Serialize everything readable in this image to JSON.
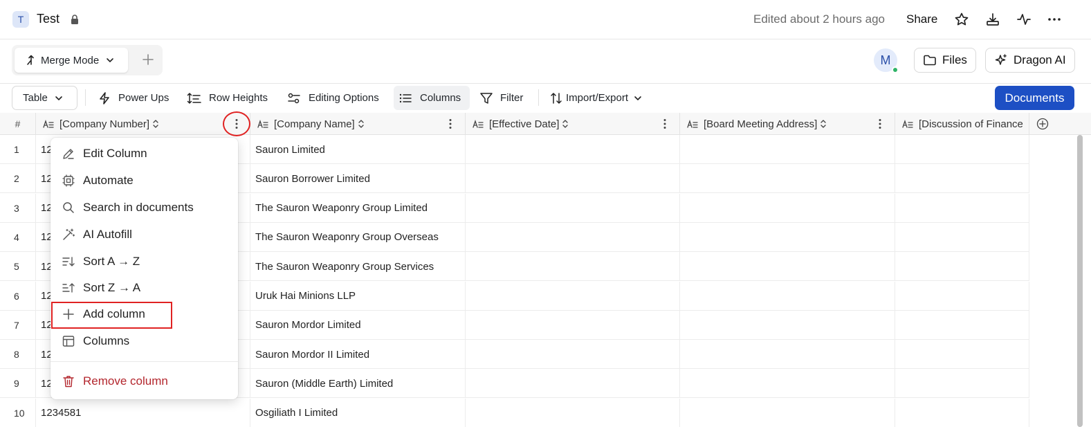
{
  "header": {
    "doc_avatar": "T",
    "title": "Test",
    "edited": "Edited about 2 hours ago",
    "share": "Share"
  },
  "tabs": {
    "merge_mode": "Merge Mode"
  },
  "user": {
    "initial": "M"
  },
  "buttons": {
    "files": "Files",
    "dragon_ai": "Dragon AI",
    "documents": "Documents"
  },
  "toolbar": {
    "table": "Table",
    "power_ups": "Power Ups",
    "row_heights": "Row Heights",
    "editing_options": "Editing Options",
    "columns": "Columns",
    "filter": "Filter",
    "import_export": "Import/Export"
  },
  "grid": {
    "hash": "#",
    "columns": [
      "[Company Number]",
      "[Company Name]",
      "[Effective Date]",
      "[Board Meeting Address]",
      "[Discussion of Finance"
    ],
    "rows": [
      {
        "num": "1",
        "number": "12",
        "name": "Sauron Limited"
      },
      {
        "num": "2",
        "number": "12",
        "name": "Sauron Borrower Limited"
      },
      {
        "num": "3",
        "number": "12",
        "name": "The Sauron Weaponry Group Limited"
      },
      {
        "num": "4",
        "number": "12",
        "name": "The Sauron Weaponry Group Overseas"
      },
      {
        "num": "5",
        "number": "12",
        "name": "The Sauron Weaponry Group Services"
      },
      {
        "num": "6",
        "number": "12",
        "name": "Uruk Hai Minions LLP"
      },
      {
        "num": "7",
        "number": "12",
        "name": "Sauron Mordor Limited"
      },
      {
        "num": "8",
        "number": "12",
        "name": "Sauron Mordor II Limited"
      },
      {
        "num": "9",
        "number": "12",
        "name": "Sauron (Middle Earth) Limited"
      },
      {
        "num": "10",
        "number": "1234581",
        "name": "Osgiliath I Limited"
      }
    ]
  },
  "menu": {
    "items": [
      {
        "label": "Edit Column",
        "icon": "pencil-icon"
      },
      {
        "label": "Automate",
        "icon": "chip-icon"
      },
      {
        "label": "Search in documents",
        "icon": "search-icon"
      },
      {
        "label": "AI Autofill",
        "icon": "magic-wand-icon"
      },
      {
        "label": "Sort A → Z",
        "icon": "sort-asc-icon"
      },
      {
        "label": "Sort Z → A",
        "icon": "sort-desc-icon"
      },
      {
        "label": "Add column",
        "icon": "plus-icon"
      },
      {
        "label": "Columns",
        "icon": "table-icon"
      }
    ],
    "remove": {
      "label": "Remove column",
      "icon": "trash-icon"
    }
  },
  "colors": {
    "accent": "#1d4fc4",
    "danger": "#b3262d",
    "annotation": "#e02222",
    "presence": "#2fb467"
  }
}
